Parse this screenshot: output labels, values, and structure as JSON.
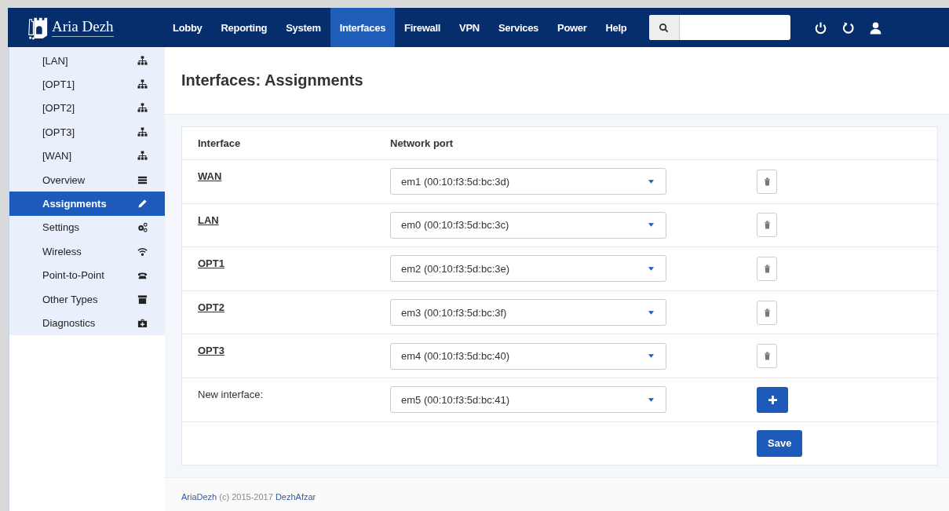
{
  "brand": {
    "name": "Aria Dezh"
  },
  "nav": [
    {
      "label": "Lobby",
      "selected": false
    },
    {
      "label": "Reporting",
      "selected": false
    },
    {
      "label": "System",
      "selected": false
    },
    {
      "label": "Interfaces",
      "selected": true
    },
    {
      "label": "Firewall",
      "selected": false
    },
    {
      "label": "VPN",
      "selected": false
    },
    {
      "label": "Services",
      "selected": false
    },
    {
      "label": "Power",
      "selected": false
    },
    {
      "label": "Help",
      "selected": false
    }
  ],
  "sidebar": {
    "items": [
      {
        "label": "[LAN]",
        "kind": "interface",
        "selected": false
      },
      {
        "label": "[OPT1]",
        "kind": "interface",
        "selected": false
      },
      {
        "label": "[OPT2]",
        "kind": "interface",
        "selected": false
      },
      {
        "label": "[OPT3]",
        "kind": "interface",
        "selected": false
      },
      {
        "label": "[WAN]",
        "kind": "interface",
        "selected": false
      },
      {
        "label": "Overview",
        "kind": "page",
        "selected": false
      },
      {
        "label": "Assignments",
        "kind": "page",
        "selected": true
      },
      {
        "label": "Settings",
        "kind": "page",
        "selected": false
      },
      {
        "label": "Wireless",
        "kind": "page",
        "selected": false
      },
      {
        "label": "Point-to-Point",
        "kind": "page",
        "selected": false
      },
      {
        "label": "Other Types",
        "kind": "page",
        "selected": false
      },
      {
        "label": "Diagnostics",
        "kind": "page",
        "selected": false
      }
    ]
  },
  "page": {
    "title": "Interfaces: Assignments"
  },
  "table": {
    "columns": [
      "Interface",
      "Network port"
    ],
    "rows": [
      {
        "interface": "WAN",
        "port": "em1 (00:10:f3:5d:bc:3d)"
      },
      {
        "interface": "LAN",
        "port": "em0 (00:10:f3:5d:bc:3c)"
      },
      {
        "interface": "OPT1",
        "port": "em2 (00:10:f3:5d:bc:3e)"
      },
      {
        "interface": "OPT2",
        "port": "em3 (00:10:f3:5d:bc:3f)"
      },
      {
        "interface": "OPT3",
        "port": "em4 (00:10:f3:5d:bc:40)"
      }
    ]
  },
  "new_interface": {
    "label": "New interface:",
    "port": "em5 (00:10:f3:5d:bc:41)"
  },
  "save_button": "Save",
  "footer": {
    "brand_link": "AriaDezh",
    "text": "(c) 2015-2017",
    "company_link": "DezhAfzar"
  }
}
